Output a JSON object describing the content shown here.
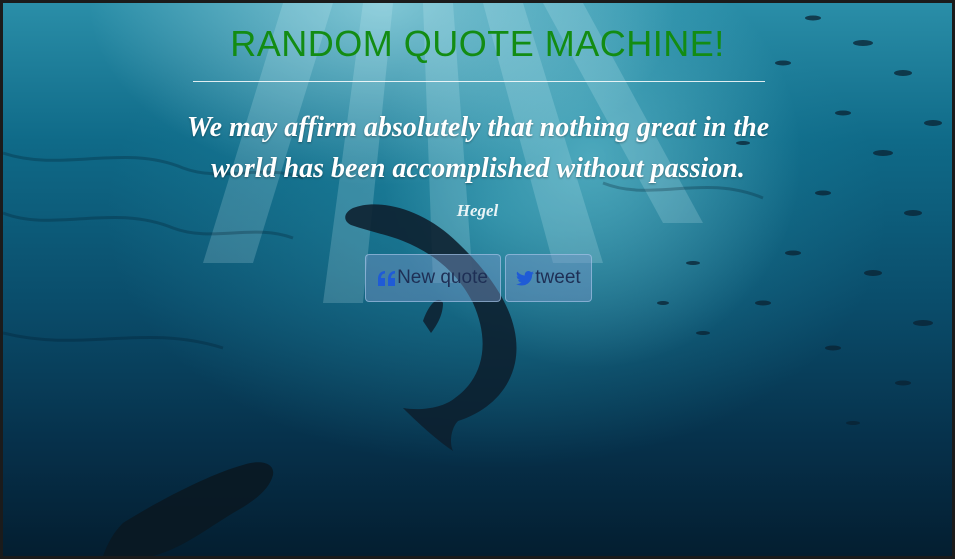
{
  "title": "RANDOM QUOTE MACHINE!",
  "quote": {
    "text": "We may affirm absolutely that nothing great in the world has been accomplished without passion.",
    "author": "Hegel"
  },
  "buttons": {
    "new_quote": "New quote",
    "tweet": "tweet"
  },
  "icons": {
    "quote": "quote-left-icon",
    "twitter": "twitter-icon"
  },
  "colors": {
    "title": "#138c13",
    "icon": "#1f5bd6"
  }
}
